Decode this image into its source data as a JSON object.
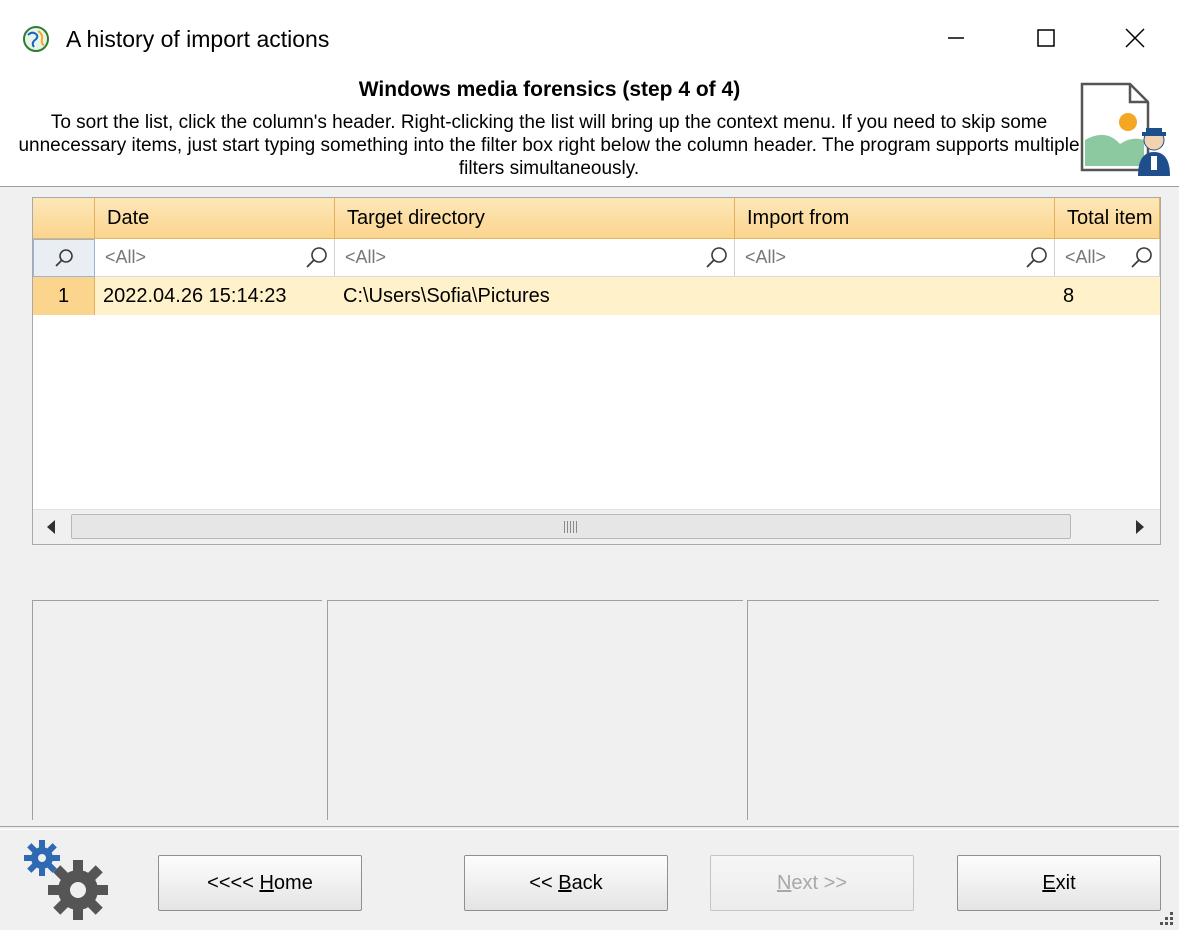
{
  "window": {
    "title": "A history of import actions",
    "icon": "app-globe-icon"
  },
  "header": {
    "step_title": "Windows media forensics (step 4 of 4)",
    "description": "To sort the list, click the column's header. Right-clicking the list will bring up the context menu. If you need to skip some unnecessary items, just start typing something into the filter box right below the column header. The program supports multiple filters simultaneously."
  },
  "grid": {
    "columns": [
      "Date",
      "Target directory",
      "Import from",
      "Total item"
    ],
    "filters": [
      "<All>",
      "<All>",
      "<All>",
      "<All>"
    ],
    "rows": [
      {
        "index": "1",
        "date": "2022.04.26 15:14:23",
        "target": "C:\\Users\\Sofia\\Pictures",
        "import_from": "",
        "total": "8"
      }
    ]
  },
  "buttons": {
    "home_prefix": "<<<< ",
    "home_ul": "H",
    "home_rest": "ome",
    "back_prefix": "<< ",
    "back_ul": "B",
    "back_rest": "ack",
    "next_ul": "N",
    "next_rest": "ext >>",
    "exit_ul": "E",
    "exit_rest": "xit"
  },
  "colors": {
    "header_orange": "#fbd58e",
    "row_highlight": "#fff1c9"
  }
}
